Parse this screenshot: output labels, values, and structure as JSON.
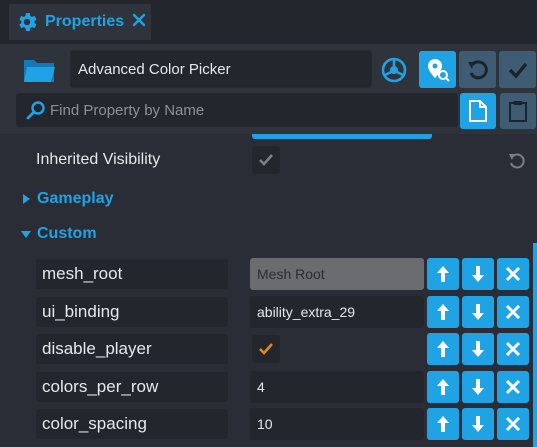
{
  "tab": {
    "title": "Properties",
    "icon": "gear-icon",
    "close_icon": "close-icon"
  },
  "toolbar": {
    "object_name": "Advanced Color Picker",
    "search_placeholder": "Find Property by Name"
  },
  "inherited": {
    "label": "Inherited Visibility",
    "checked": true
  },
  "sections": {
    "gameplay": "Gameplay",
    "custom": "Custom"
  },
  "custom_props": [
    {
      "label": "mesh_root",
      "value": "Mesh Root",
      "type": "reference"
    },
    {
      "label": "ui_binding",
      "value": "ability_extra_29",
      "type": "text"
    },
    {
      "label": "disable_player",
      "value": "",
      "type": "checkbox",
      "checked": true
    },
    {
      "label": "colors_per_row",
      "value": "4",
      "type": "number"
    },
    {
      "label": "color_spacing",
      "value": "10",
      "type": "number"
    }
  ],
  "colors": {
    "accent": "#1fa3e5",
    "panel": "#2a2d35",
    "field": "#23262d",
    "check_orange": "#e08a1e"
  }
}
